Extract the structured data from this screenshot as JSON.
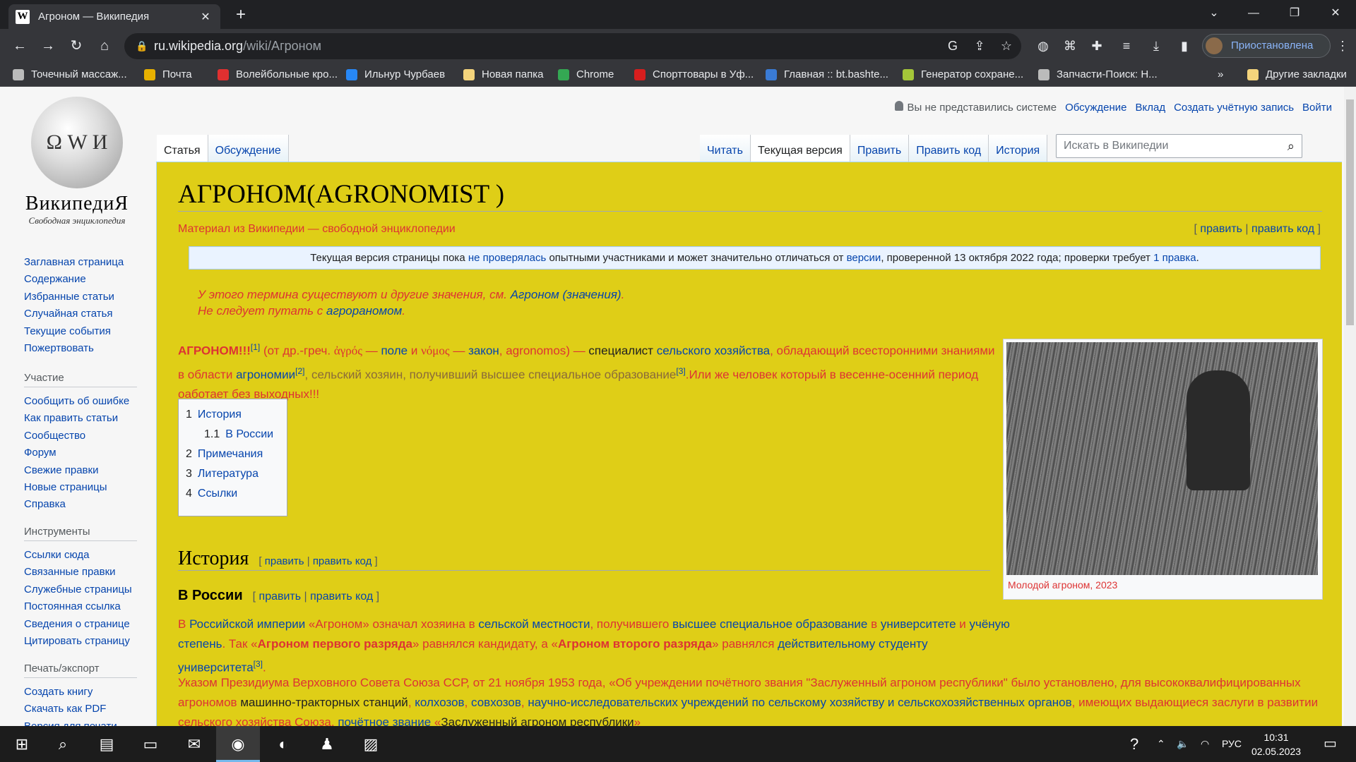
{
  "browser": {
    "tab_title": "Агроном — Википедия",
    "tab_favicon": "W",
    "url_host": "ru.wikipedia.org",
    "url_path": "/wiki/Агроном",
    "profile_label": "Приостановлена",
    "bookmarks": [
      {
        "label": "Точечный массаж...",
        "icon": "globe-icon",
        "color": "#bbbbbb"
      },
      {
        "label": "Почта",
        "icon": "mail-icon",
        "color": "#e8b100"
      },
      {
        "label": "Волейбольные кро...",
        "icon": "shoe-icon",
        "color": "#e03030"
      },
      {
        "label": "Ильнур Чурбаев",
        "icon": "vk-icon",
        "color": "#2787f5"
      },
      {
        "label": "Новая папка",
        "icon": "folder-icon",
        "color": "#f4d47c"
      },
      {
        "label": "Chrome",
        "icon": "chrome-icon",
        "color": "#34a853"
      },
      {
        "label": "Спорттовары в Уф...",
        "icon": "sport-icon",
        "color": "#d81e1e"
      },
      {
        "label": "Главная :: bt.bashte...",
        "icon": "bt-icon",
        "color": "#3a7bd5"
      },
      {
        "label": "Генератор сохране...",
        "icon": "android-icon",
        "color": "#a4c639"
      },
      {
        "label": "Запчасти-Поиск: Н...",
        "icon": "globe-icon",
        "color": "#bbbbbb"
      }
    ],
    "more_bookmarks": "»",
    "other_bookmarks": "Другие закладки"
  },
  "wiki": {
    "logo_title": "ВикипедиЯ",
    "logo_subtitle": "Свободная энциклопедия",
    "personal": {
      "not_logged": "Вы не представились системе",
      "talk": "Обсуждение",
      "contrib": "Вклад",
      "create": "Создать учётную запись",
      "login": "Войти"
    },
    "nav_main": [
      "Заглавная страница",
      "Содержание",
      "Избранные статьи",
      "Случайная статья",
      "Текущие события",
      "Пожертвовать"
    ],
    "nav_participation_title": "Участие",
    "nav_participation": [
      "Сообщить об ошибке",
      "Как править статьи",
      "Сообщество",
      "Форум",
      "Свежие правки",
      "Новые страницы",
      "Справка"
    ],
    "nav_tools_title": "Инструменты",
    "nav_tools": [
      "Ссылки сюда",
      "Связанные правки",
      "Служебные страницы",
      "Постоянная ссылка",
      "Сведения о странице",
      "Цитировать страницу"
    ],
    "nav_print_title": "Печать/экспорт",
    "nav_print": [
      "Создать книгу",
      "Скачать как PDF",
      "Версия для печати"
    ],
    "tabs_left": [
      "Статья",
      "Обсуждение"
    ],
    "tabs_right": [
      "Читать",
      "Текущая версия",
      "Править",
      "Править код",
      "История"
    ],
    "search_placeholder": "Искать в Википедии"
  },
  "article": {
    "title": "АГРОНОМ(AGRONOMIST )",
    "tagline": "Материал из Википедии — свободной энциклопедии",
    "edit": "править",
    "edit_code": "править код",
    "notice_1": "Текущая версия страницы пока ",
    "notice_link1": "не проверялась",
    "notice_2": " опытными участниками и может значительно отличаться от ",
    "notice_link2": "версии",
    "notice_3": ", проверенной 13 октября 2022 года; проверки требует ",
    "notice_link3": "1 правка",
    "hatnote1_text": "У этого термина существуют и другие значения, см. ",
    "hatnote1_link": "Агроном (значения)",
    "hatnote2_text": "Не следует путать с ",
    "hatnote2_link": "агрораномом",
    "lead": {
      "term": "АГРОНОМ!!!",
      "ref1": "[1]",
      "p1": " (от др.-греч. ",
      "greek1": "ἀγρός",
      "p2": " — ",
      "field": "поле",
      "p3": " и ",
      "greek2": "νόμος",
      "p4": " — ",
      "law": "закон",
      "p5": ", ",
      "agronomos": "agronomos",
      "p6": ") — ",
      "specialist": "специалист ",
      "agri": "сельского хозяйства",
      "p7": ", обладающий всесторонними знаниями в области ",
      "agronomy": "агрономии",
      "ref2": "[2]",
      "p8": ", сельский хозяин, получивший высшее специальное образование",
      "ref3": "[3]",
      "p9": ".Или же человек который в весенне-осенний период оаботает без выходных!!!"
    },
    "toc": [
      {
        "num": "1",
        "label": "История"
      },
      {
        "num": "1.1",
        "label": "В России"
      },
      {
        "num": "2",
        "label": "Примечания"
      },
      {
        "num": "3",
        "label": "Литература"
      },
      {
        "num": "4",
        "label": "Ссылки"
      }
    ],
    "image_caption": "Молодой агроном, 2023",
    "h2_history": "История",
    "h3_russia": "В России",
    "russia_p1": {
      "a": "В ",
      "empire": "Российской империи",
      "b": " «Агроном» означал хозяина в ",
      "rural": "сельской местности",
      "c": ", получившего ",
      "higher": "высшее специальное образование",
      "d": " в ",
      "uni": "университете",
      "e": " и ",
      "degree": "учёную степень",
      "f": ". Так «",
      "first": "Агроном первого разряда",
      "g": "» равнялся кандидату, а «",
      "second": "Агроном второго разряда",
      "h": "» равнялся ",
      "student": "действительному студенту",
      "i": " ",
      "uni2": "университета",
      "ref": "[3]",
      "j": "."
    },
    "russia_p2": {
      "a": "Указом Президиума Верховного Совета Союза ССР, от 21 ноября 1953 года, «Об учреждении почётного звания \"Заслуженный агроном республики\" было установлено, для высококвалифицированных агрономов ",
      "mts": "машинно-тракторных станций",
      "b": ", ",
      "kolhoz": "колхозов",
      "c": ", ",
      "sovhoz": "совхозов",
      "d": ", ",
      "nii": "научно-исследовательских учреждений по сельскому хозяйству и сельскохозяйственных органов",
      "e": ", имеющих выдающиеся заслуги в развитии сельского хозяйства Союза, ",
      "honor": "почётное звание",
      "f": " «",
      "zasl": "Заслуженный агроном республики",
      "g": "»"
    }
  },
  "taskbar": {
    "lang": "РУС",
    "time": "10:31",
    "date": "02.05.2023"
  }
}
